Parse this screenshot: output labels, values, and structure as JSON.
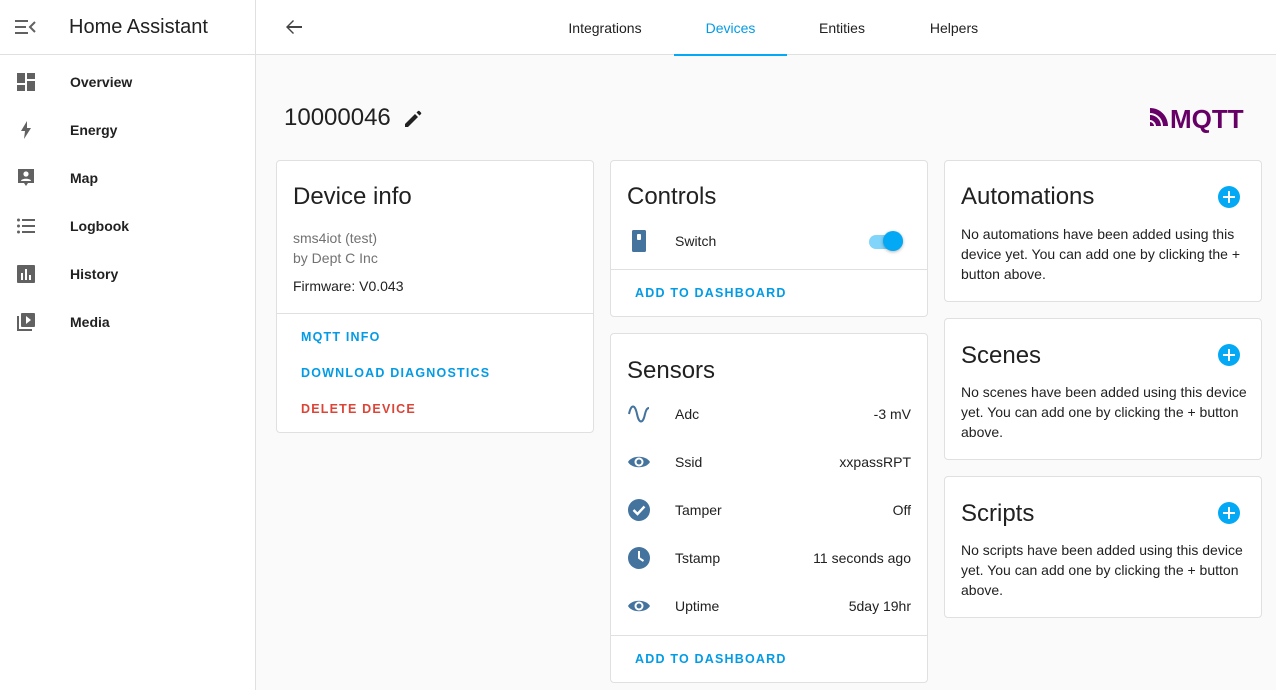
{
  "app": {
    "title": "Home Assistant"
  },
  "sidebar": {
    "items": [
      {
        "label": "Overview",
        "icon": "dashboard-icon"
      },
      {
        "label": "Energy",
        "icon": "lightning-bolt-icon"
      },
      {
        "label": "Map",
        "icon": "account-box-icon"
      },
      {
        "label": "Logbook",
        "icon": "format-list-bulleted-icon"
      },
      {
        "label": "History",
        "icon": "chart-box-icon"
      },
      {
        "label": "Media",
        "icon": "play-box-multiple-icon"
      }
    ]
  },
  "tabs": [
    {
      "label": "Integrations",
      "active": false
    },
    {
      "label": "Devices",
      "active": true
    },
    {
      "label": "Entities",
      "active": false
    },
    {
      "label": "Helpers",
      "active": false
    }
  ],
  "device": {
    "name": "10000046",
    "logo_text": "MQTT"
  },
  "device_info": {
    "title": "Device info",
    "model": "sms4iot (test)",
    "manufacturer": "by Dept C Inc",
    "firmware": "Firmware: V0.043",
    "actions": {
      "mqtt_info": "MQTT INFO",
      "download_diagnostics": "DOWNLOAD DIAGNOSTICS",
      "delete_device": "DELETE DEVICE"
    }
  },
  "controls": {
    "title": "Controls",
    "rows": [
      {
        "name": "Switch",
        "icon": "switch-icon",
        "state": "on"
      }
    ],
    "add_label": "ADD TO DASHBOARD"
  },
  "sensors": {
    "title": "Sensors",
    "rows": [
      {
        "name": "Adc",
        "value": "-3 mV",
        "icon": "sine-wave-icon"
      },
      {
        "name": "Ssid",
        "value": "xxpassRPT",
        "icon": "eye-icon"
      },
      {
        "name": "Tamper",
        "value": "Off",
        "icon": "check-circle-icon"
      },
      {
        "name": "Tstamp",
        "value": "11 seconds ago",
        "icon": "clock-icon"
      },
      {
        "name": "Uptime",
        "value": "5day 19hr",
        "icon": "eye-icon"
      }
    ],
    "add_label": "ADD TO DASHBOARD"
  },
  "automations": {
    "title": "Automations",
    "desc": "No automations have been added using this device yet. You can add one by clicking the + button above."
  },
  "scenes": {
    "title": "Scenes",
    "desc": "No scenes have been added using this device yet. You can add one by clicking the + button above."
  },
  "scripts": {
    "title": "Scripts",
    "desc": "No scripts have been added using this device yet. You can add one by clicking the + button above."
  },
  "colors": {
    "accent": "#03a9f4",
    "link": "#039be5",
    "danger": "#db4437",
    "icon": "#44739e",
    "mqtt": "#660066"
  }
}
